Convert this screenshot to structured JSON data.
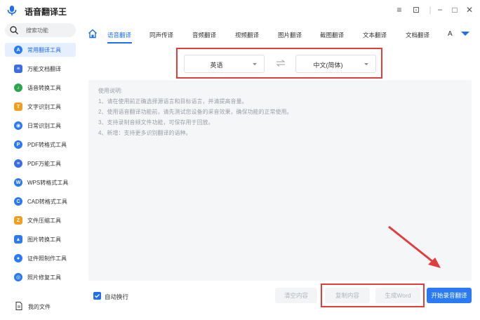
{
  "app": {
    "title": "语音翻译王"
  },
  "window_controls": {
    "menu": "≡",
    "pin": "⊡",
    "minimize": "−",
    "maximize": "□",
    "close": "✕"
  },
  "search": {
    "placeholder": "搜索功能"
  },
  "sidebar": {
    "items": [
      {
        "label": "常用翻译工具",
        "icon": "translate-icon",
        "color": "#2a7af5",
        "active": true
      },
      {
        "label": "万能文档翻译",
        "icon": "document-icon",
        "color": "#3b6fe0",
        "active": false
      },
      {
        "label": "语音转换工具",
        "icon": "voice-icon",
        "color": "#2ba64f",
        "active": false
      },
      {
        "label": "文字识别工具",
        "icon": "text-recognize-icon",
        "color": "#f0a020",
        "active": false
      },
      {
        "label": "日常识别工具",
        "icon": "daily-recognize-icon",
        "color": "#2a7af5",
        "active": false
      },
      {
        "label": "PDF转格式工具",
        "icon": "pdf-convert-icon",
        "color": "#2a7af5",
        "active": false
      },
      {
        "label": "PDF万能工具",
        "icon": "pdf-tool-icon",
        "color": "#3b6fe0",
        "active": false
      },
      {
        "label": "WPS转格式工具",
        "icon": "wps-icon",
        "color": "#2a7af5",
        "active": false
      },
      {
        "label": "CAD转格式工具",
        "icon": "cad-icon",
        "color": "#2a7af5",
        "active": false
      },
      {
        "label": "文件压缩工具",
        "icon": "compress-icon",
        "color": "#f0a020",
        "active": false
      },
      {
        "label": "图片转换工具",
        "icon": "image-convert-icon",
        "color": "#2a7af5",
        "active": false
      },
      {
        "label": "证件照制作工具",
        "icon": "id-photo-icon",
        "color": "#2a7af5",
        "active": false
      },
      {
        "label": "照片修复工具",
        "icon": "photo-repair-icon",
        "color": "#2a7af5",
        "active": false
      }
    ],
    "my_files": "我的文件"
  },
  "tabs": {
    "items": [
      "语音翻译",
      "同声传译",
      "音频翻译",
      "视频翻译",
      "图片翻译",
      "截图翻译",
      "文本翻译",
      "文档翻译"
    ],
    "more": "A"
  },
  "lang": {
    "source": "英语",
    "target": "中文(简体)"
  },
  "instructions": {
    "title": "使用说明:",
    "lines": [
      "1、请在使用前正确选择源语言和目标语言，并清提高音量。",
      "2、使用语音翻译功能前，请先测试您设备的采音效果，确保功能的正常使用。",
      "3、支持录制音频文件功能，可保存用于回放。",
      "4、新增：支持更多识别翻译的语种。"
    ]
  },
  "footer": {
    "auto_wrap": "自动换行",
    "clear": "清空内容",
    "copy": "复制内容",
    "word": "生成Word",
    "start": "开始录音翻译"
  },
  "colors": {
    "accent": "#1f6ff0",
    "highlight": "#e23c3c"
  }
}
